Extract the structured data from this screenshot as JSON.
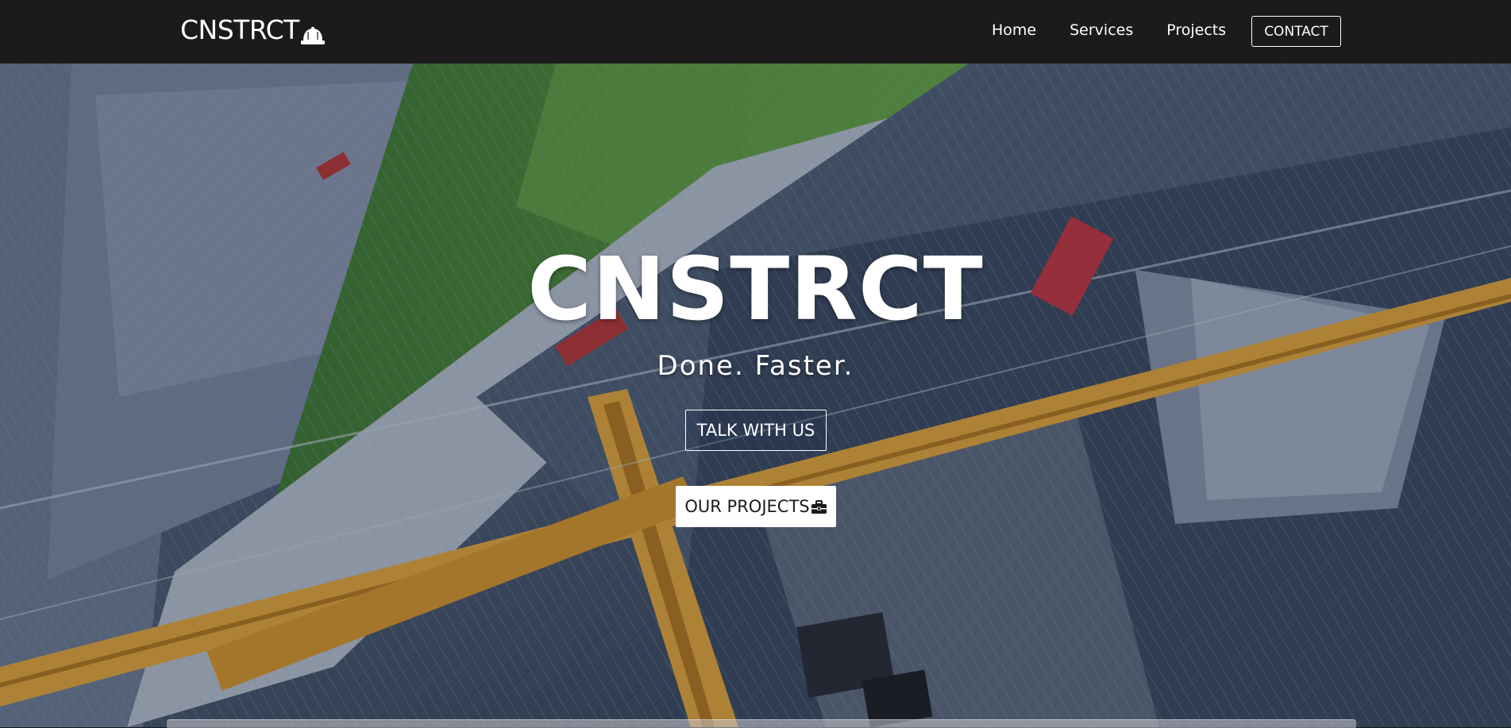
{
  "nav": {
    "brand": "CNSTRCT",
    "brand_icon": "hard-hat-icon",
    "links": [
      "Home",
      "Services",
      "Projects"
    ],
    "contact_label": "CONTACT"
  },
  "hero": {
    "title": "CNSTRCT",
    "subtitle": "Done. Faster.",
    "talk_label": "TALK WITH US",
    "projects_label": "OUR PROJECTS",
    "projects_icon": "toolbox-icon",
    "background": "aerial construction site with yellow crane"
  },
  "colors": {
    "navbar": "#1b1b1b",
    "text": "#ffffff",
    "crane": "#e0a53a",
    "grass": "#4f8a3a"
  }
}
